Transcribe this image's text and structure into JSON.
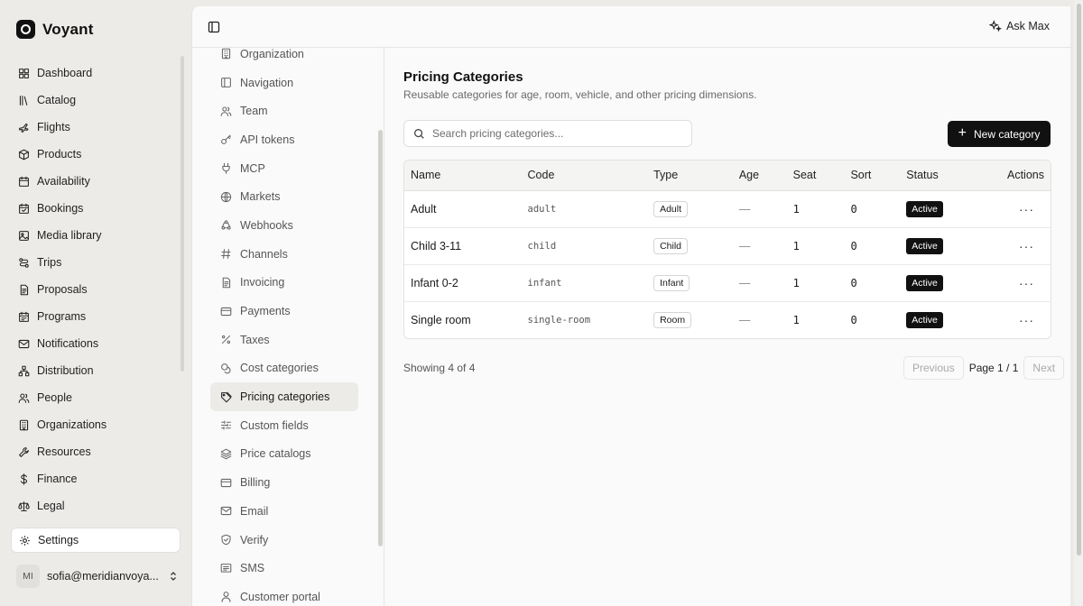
{
  "app": {
    "name": "Voyant",
    "nav": [
      {
        "label": "Dashboard",
        "icon": "grid-icon"
      },
      {
        "label": "Catalog",
        "icon": "library-icon"
      },
      {
        "label": "Flights",
        "icon": "plane-icon"
      },
      {
        "label": "Products",
        "icon": "package-icon"
      },
      {
        "label": "Availability",
        "icon": "calendar-icon"
      },
      {
        "label": "Bookings",
        "icon": "calendar-check-icon"
      },
      {
        "label": "Media library",
        "icon": "image-icon"
      },
      {
        "label": "Trips",
        "icon": "route-icon"
      },
      {
        "label": "Proposals",
        "icon": "document-icon"
      },
      {
        "label": "Programs",
        "icon": "calendar-range-icon"
      },
      {
        "label": "Notifications",
        "icon": "mail-icon"
      },
      {
        "label": "Distribution",
        "icon": "network-icon"
      },
      {
        "label": "People",
        "icon": "users-icon"
      },
      {
        "label": "Organizations",
        "icon": "building-icon"
      },
      {
        "label": "Resources",
        "icon": "wrench-icon"
      },
      {
        "label": "Finance",
        "icon": "dollar-icon"
      },
      {
        "label": "Legal",
        "icon": "scale-icon"
      }
    ],
    "settings_label": "Settings",
    "user": {
      "initials": "MI",
      "email": "sofia@meridianvoya..."
    }
  },
  "topbar": {
    "ask_label": "Ask Max"
  },
  "settings_nav": [
    {
      "label": "Organization",
      "icon": "building-icon",
      "active": false
    },
    {
      "label": "Navigation",
      "icon": "panel-icon",
      "active": false
    },
    {
      "label": "Team",
      "icon": "users-icon",
      "active": false
    },
    {
      "label": "API tokens",
      "icon": "key-icon",
      "active": false
    },
    {
      "label": "MCP",
      "icon": "plug-icon",
      "active": false
    },
    {
      "label": "Markets",
      "icon": "globe-icon",
      "active": false
    },
    {
      "label": "Webhooks",
      "icon": "webhook-icon",
      "active": false
    },
    {
      "label": "Channels",
      "icon": "hash-icon",
      "active": false
    },
    {
      "label": "Invoicing",
      "icon": "document-icon",
      "active": false
    },
    {
      "label": "Payments",
      "icon": "credit-card-icon",
      "active": false
    },
    {
      "label": "Taxes",
      "icon": "percent-icon",
      "active": false
    },
    {
      "label": "Cost categories",
      "icon": "coins-icon",
      "active": false
    },
    {
      "label": "Pricing categories",
      "icon": "tag-icon",
      "active": true
    },
    {
      "label": "Custom fields",
      "icon": "sliders-icon",
      "active": false
    },
    {
      "label": "Price catalogs",
      "icon": "layers-icon",
      "active": false
    },
    {
      "label": "Billing",
      "icon": "credit-card-icon",
      "active": false
    },
    {
      "label": "Email",
      "icon": "mail-icon",
      "active": false
    },
    {
      "label": "Verify",
      "icon": "shield-check-icon",
      "active": false
    },
    {
      "label": "SMS",
      "icon": "message-icon",
      "active": false
    },
    {
      "label": "Customer portal",
      "icon": "user-icon",
      "active": false
    }
  ],
  "page": {
    "title": "Pricing Categories",
    "subtitle": "Reusable categories for age, room, vehicle, and other pricing dimensions.",
    "search_placeholder": "Search pricing categories...",
    "new_button": "New category",
    "columns": [
      "Name",
      "Code",
      "Type",
      "Age",
      "Seat",
      "Sort",
      "Status",
      "Actions"
    ],
    "rows": [
      {
        "name": "Adult",
        "code": "adult",
        "type": "Adult",
        "age": "—",
        "seat": "1",
        "sort": "0",
        "status": "Active"
      },
      {
        "name": "Child 3-11",
        "code": "child",
        "type": "Child",
        "age": "—",
        "seat": "1",
        "sort": "0",
        "status": "Active"
      },
      {
        "name": "Infant 0-2",
        "code": "infant",
        "type": "Infant",
        "age": "—",
        "seat": "1",
        "sort": "0",
        "status": "Active"
      },
      {
        "name": "Single room",
        "code": "single-room",
        "type": "Room",
        "age": "—",
        "seat": "1",
        "sort": "0",
        "status": "Active"
      }
    ],
    "showing": "Showing 4 of 4",
    "pagination": {
      "previous": "Previous",
      "page": "Page 1 / 1",
      "next": "Next"
    }
  }
}
